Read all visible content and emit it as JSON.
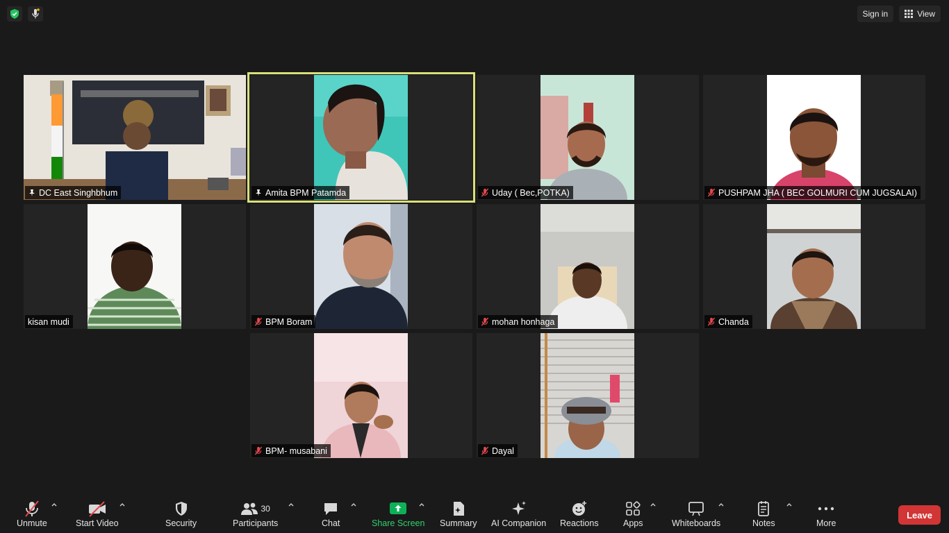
{
  "top": {
    "sign_in": "Sign in",
    "view": "View"
  },
  "tiles": [
    {
      "name": "DC East Singhbhum",
      "mic": "spotlight"
    },
    {
      "name": "Amita BPM Patamda",
      "mic": "spotlight",
      "active": true
    },
    {
      "name": "Uday ( Bec,POTKA)",
      "mic": "muted"
    },
    {
      "name": "PUSHPAM JHA ( BEC GOLMURI CUM JUGSALAI)",
      "mic": "muted"
    },
    {
      "name": "kisan mudi",
      "mic": "none"
    },
    {
      "name": "BPM Boram",
      "mic": "muted"
    },
    {
      "name": "mohan honhaga",
      "mic": "muted"
    },
    {
      "name": "Chanda",
      "mic": "muted"
    },
    {
      "name": "BPM- musabani",
      "mic": "muted"
    },
    {
      "name": "Dayal",
      "mic": "muted"
    }
  ],
  "toolbar": {
    "unmute": "Unmute",
    "start_video": "Start Video",
    "security": "Security",
    "participants": "Participants",
    "participants_count": "30",
    "chat": "Chat",
    "share_screen": "Share Screen",
    "summary": "Summary",
    "ai_companion": "AI Companion",
    "reactions": "Reactions",
    "apps": "Apps",
    "whiteboards": "Whiteboards",
    "notes": "Notes",
    "more": "More",
    "leave": "Leave"
  },
  "colors": {
    "background": "#1a1a1a",
    "tile": "#242424",
    "active_speaker": "#d9e07a",
    "share_green": "#2fd26e",
    "leave_red": "#d13535",
    "muted_red": "#e5484d"
  }
}
